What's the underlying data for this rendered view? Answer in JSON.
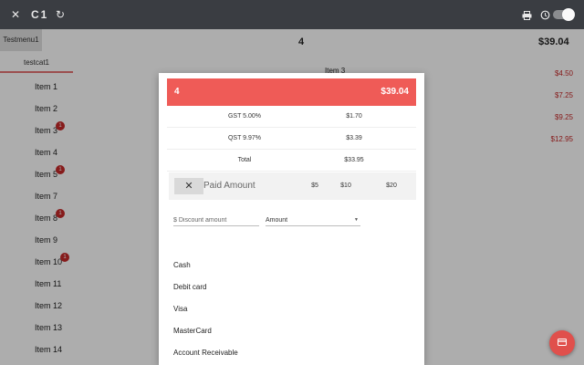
{
  "topbar": {
    "close_icon": "close-icon",
    "title": "C1",
    "refresh_icon": "refresh-icon",
    "print_icon": "print-icon",
    "history_icon": "history-icon"
  },
  "menu": {
    "tab_label": "Testmenu1",
    "category_label": "testcat1"
  },
  "order": {
    "quantity": "4",
    "total": "$39.04",
    "line_name": "Item 3",
    "line_prices": [
      "$4.50",
      "$7.25",
      "$9.25",
      "$12.95"
    ]
  },
  "items": [
    {
      "label": "Item 1",
      "badge": ""
    },
    {
      "label": "Item 2",
      "badge": ""
    },
    {
      "label": "Item 3",
      "badge": "1"
    },
    {
      "label": "Item 4",
      "badge": ""
    },
    {
      "label": "Item 5",
      "badge": "1"
    },
    {
      "label": "Item 7",
      "badge": ""
    },
    {
      "label": "Item 8",
      "badge": "1"
    },
    {
      "label": "Item 9",
      "badge": ""
    },
    {
      "label": "Item 10",
      "badge": "1"
    },
    {
      "label": "Item 11",
      "badge": ""
    },
    {
      "label": "Item 12",
      "badge": ""
    },
    {
      "label": "Item 13",
      "badge": ""
    },
    {
      "label": "Item 14",
      "badge": ""
    }
  ],
  "payment_dialog": {
    "quantity": "4",
    "total": "$39.04",
    "taxes": [
      {
        "label": "GST 5.00%",
        "value": "$1.70"
      },
      {
        "label": "QST 9.97%",
        "value": "$3.39"
      },
      {
        "label": "Total",
        "value": "$33.95"
      }
    ],
    "clear_icon": "close-icon",
    "paid_amount_label": "Paid Amount",
    "quick_amounts": [
      "$5",
      "$10",
      "$20"
    ],
    "discount_placeholder": "$ Discount amount",
    "discount_type": "Amount",
    "payment_methods": [
      "Cash",
      "Debit card",
      "Visa",
      "MasterCard",
      "Account Receivable"
    ]
  },
  "fab": {
    "icon": "payment-card-icon"
  },
  "colors": {
    "topbar": "#3a3d42",
    "accent": "#ef5b57",
    "badge": "#c62828"
  }
}
